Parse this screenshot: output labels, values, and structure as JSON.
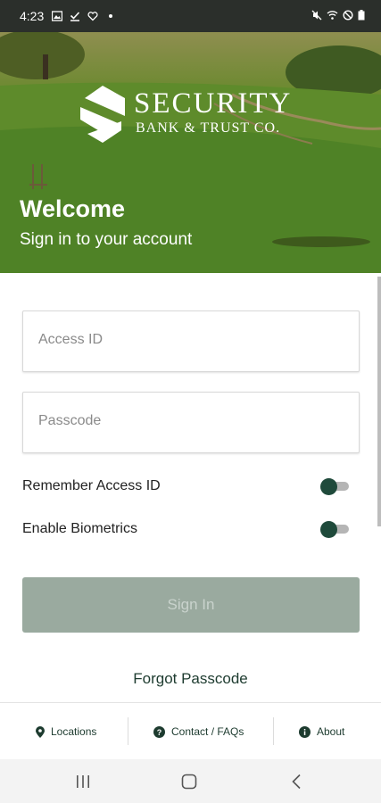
{
  "status_bar": {
    "time": "4:23",
    "left_icons": [
      "image-icon",
      "check-download-icon",
      "heart-icon",
      "dot-icon"
    ],
    "right_icons": [
      "mute-icon",
      "wifi-icon",
      "do-not-disturb-icon",
      "battery-icon"
    ]
  },
  "header": {
    "brand_name": "SECURITY",
    "brand_sub": "BANK & TRUST CO.",
    "welcome": "Welcome",
    "subtitle": "Sign in to your account"
  },
  "form": {
    "access_id_placeholder": "Access ID",
    "passcode_placeholder": "Passcode",
    "remember_label": "Remember Access ID",
    "remember_on": false,
    "biometrics_label": "Enable Biometrics",
    "biometrics_on": false,
    "signin_label": "Sign In",
    "forgot_label": "Forgot Passcode"
  },
  "footer": {
    "locations": "Locations",
    "contact": "Contact / FAQs",
    "about": "About"
  },
  "colors": {
    "accent": "#1f4a3b",
    "button_disabled": "#9aaa9f",
    "status_bar": "#2b2f2b"
  }
}
